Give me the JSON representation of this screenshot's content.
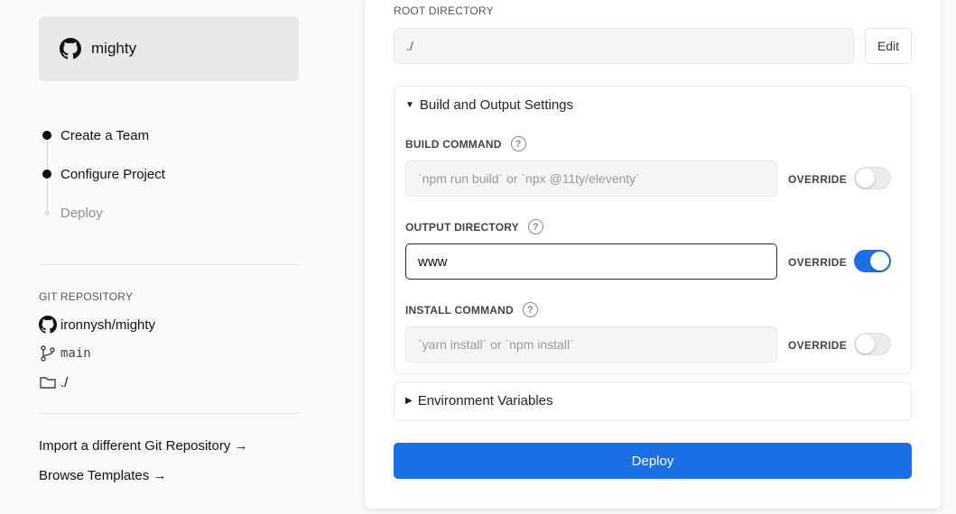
{
  "sidebar": {
    "repo_name": "mighty",
    "steps": [
      {
        "label": "Create a Team",
        "state": "done"
      },
      {
        "label": "Configure Project",
        "state": "current"
      },
      {
        "label": "Deploy",
        "state": "pending"
      }
    ],
    "git_section_title": "GIT REPOSITORY",
    "repo_full": "ironnysh/mighty",
    "branch": "main",
    "folder": "./",
    "links": [
      "Import a different Git Repository →",
      "Browse Templates →"
    ]
  },
  "main": {
    "root_directory_label": "ROOT DIRECTORY",
    "root_directory_value": "./",
    "edit_label": "Edit",
    "build_settings": {
      "title": "Build and Output Settings",
      "build_command": {
        "label": "BUILD COMMAND",
        "placeholder": "`npm run build` or `npx @11ty/eleventy`",
        "override_label": "OVERRIDE",
        "override_on": false
      },
      "output_directory": {
        "label": "OUTPUT DIRECTORY",
        "value": "www",
        "override_label": "OVERRIDE",
        "override_on": true
      },
      "install_command": {
        "label": "INSTALL COMMAND",
        "placeholder": "`yarn install` or `npm install`",
        "override_label": "OVERRIDE",
        "override_on": false
      },
      "help_glyph": "?"
    },
    "env_vars_title": "Environment Variables",
    "deploy_label": "Deploy"
  },
  "colors": {
    "accent": "#1b6fe4",
    "background": "#fafafa",
    "card": "#ffffff"
  },
  "icons": [
    "github-icon",
    "branch-icon",
    "folder-icon",
    "caret-down-icon",
    "caret-right-icon",
    "help-icon"
  ]
}
